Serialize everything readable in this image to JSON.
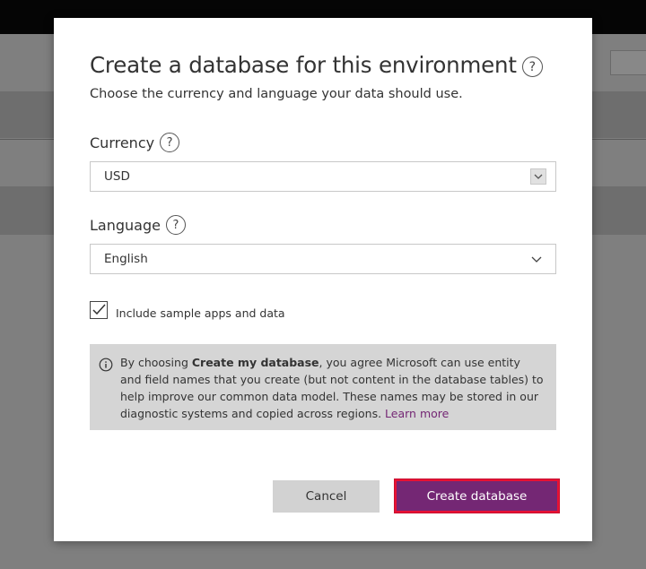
{
  "dialog": {
    "title": "Create a database for this environment",
    "subtitle": "Choose the currency and language your data should use.",
    "currency": {
      "label": "Currency",
      "value": "USD"
    },
    "language": {
      "label": "Language",
      "value": "English"
    },
    "sample_data": {
      "label": "Include sample apps and data",
      "checked": true
    },
    "info": {
      "text_before": "By choosing ",
      "bold_text": "Create my database",
      "text_after": ", you agree Microsoft can use entity and field names that you create (but not content in the database tables) to help improve our common data model. These names may be stored in our diagnostic systems and copied across regions. ",
      "link_text": "Learn more"
    },
    "buttons": {
      "cancel_label": "Cancel",
      "create_label": "Create database"
    }
  },
  "icons": {
    "help": "question-circle-icon",
    "dropdown": "chevron-down-icon",
    "check": "checkmark-icon",
    "info": "info-circle-icon"
  },
  "colors": {
    "primary_button": "#742774",
    "highlight_border": "#e81134",
    "link": "#742774",
    "info_background": "#d5d5d5"
  }
}
